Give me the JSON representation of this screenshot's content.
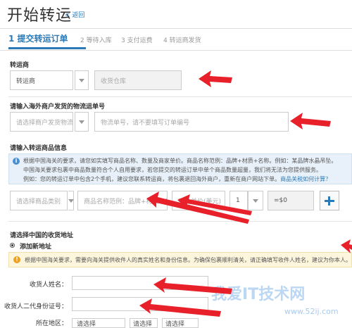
{
  "page": {
    "title": "开始转运",
    "back_label": "< 返回"
  },
  "steps": [
    {
      "label": "1  提交转运订单"
    },
    {
      "label": "2  等待入库"
    },
    {
      "label": "3  支付运费"
    },
    {
      "label": "4  转运商发货"
    }
  ],
  "carrier": {
    "section_title": "转运商",
    "select_value": "转运商",
    "warehouse_placeholder": "收货仓库"
  },
  "tracking": {
    "section_title": "请输入海外商户发货的物流运单号",
    "merchant_select": "请选择商户发货物流商",
    "tracking_placeholder": "物流单号，请不要填写订单编号"
  },
  "goods": {
    "section_title": "请输入转运商品信息",
    "notice_lines": [
      "根据中国海关的要求，请您如实填写商品名称、数量及商家单价。商品名称范例：品牌+材质+名称。例如：某品牌水晶吊坠。",
      "中国海关要求包裹中商品数量符合个人自用要求，若您提交的转运订单中单个商品数量超量，我们将无法为您提供服务。",
      "例如：您的转运订单中包含2个手机，建议您联系转运商，将包裹退回海外商户，重新在商户网站下单。"
    ],
    "notice_link": "商品关税如何计算？",
    "category_select": "请选择商品类别",
    "name_placeholder": "商品名称范例：品牌+材质+名称",
    "price_placeholder": "商品单价(美元)",
    "quantity": "1",
    "subtotal": "=$0"
  },
  "address": {
    "section_title": "请选择中国的收货地址",
    "add_new_label": "添加新地址",
    "warning": "根据中国海关要求，需要向海关提供收件人的真实姓名和身份信息。为确保包裹顺利清关，请正确填写收件人姓名，建议为你本人。",
    "name_label": "收货人姓名：",
    "id_label": "收货人二代身份证号：",
    "region_label": "所在地区：",
    "region_selects": [
      "请选择",
      "请选择",
      "请选择"
    ]
  },
  "watermark": {
    "text": "我爱IT技术网",
    "url": "www.52ij.com"
  },
  "colors": {
    "accent": "#2a7ab8",
    "arrow": "#e8202a",
    "notice_bg": "#e8f1f9",
    "warn_bg": "#fdf6dc"
  }
}
